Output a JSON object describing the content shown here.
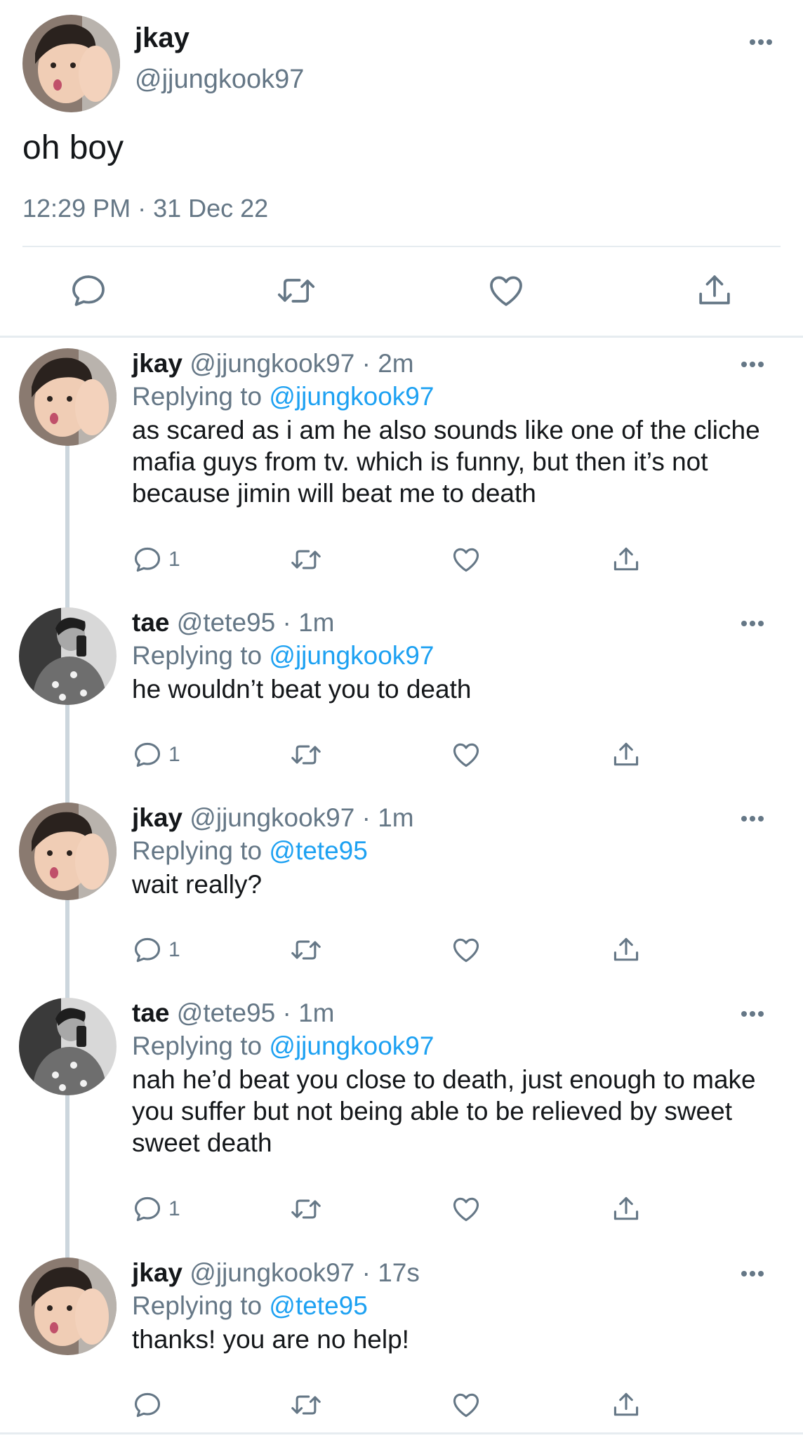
{
  "main_tweet": {
    "name": "jkay",
    "handle": "@jjungkook97",
    "text": "oh boy",
    "timestamp": "12:29 PM · 31 Dec 22",
    "icons": [
      "reply-icon",
      "retweet-icon",
      "like-icon",
      "share-icon"
    ]
  },
  "replies": [
    {
      "name": "jkay",
      "handle_time": "@jjungkook97 · 2m",
      "replying_prefix": "Replying to",
      "replying_to": "@jjungkook97",
      "text": "as scared as i am he also sounds like one of the cliche mafia guys from tv. which is funny, but then it’s not because jimin will beat me to death",
      "reply_count": "1"
    },
    {
      "name": "tae",
      "handle_time": "@tete95 · 1m",
      "replying_prefix": "Replying to",
      "replying_to": "@jjungkook97",
      "text": "he wouldn’t beat you to death",
      "reply_count": "1"
    },
    {
      "name": "jkay",
      "handle_time": "@jjungkook97 · 1m",
      "replying_prefix": "Replying to",
      "replying_to": "@tete95",
      "text": "wait really?",
      "reply_count": "1"
    },
    {
      "name": "tae",
      "handle_time": "@tete95 · 1m",
      "replying_prefix": "Replying to",
      "replying_to": "@jjungkook97",
      "text": "nah he’d beat you close to death, just enough to make you suffer but not being able to be relieved by sweet sweet death",
      "reply_count": "1"
    },
    {
      "name": "jkay",
      "handle_time": "@jjungkook97 · 17s",
      "replying_prefix": "Replying to",
      "replying_to": "@tete95",
      "text": "thanks! you are no help!",
      "reply_count": ""
    }
  ],
  "colors": {
    "text": "#14171a",
    "secondary": "#657786",
    "link": "#1da1f2",
    "divider": "#e6ecf0"
  }
}
